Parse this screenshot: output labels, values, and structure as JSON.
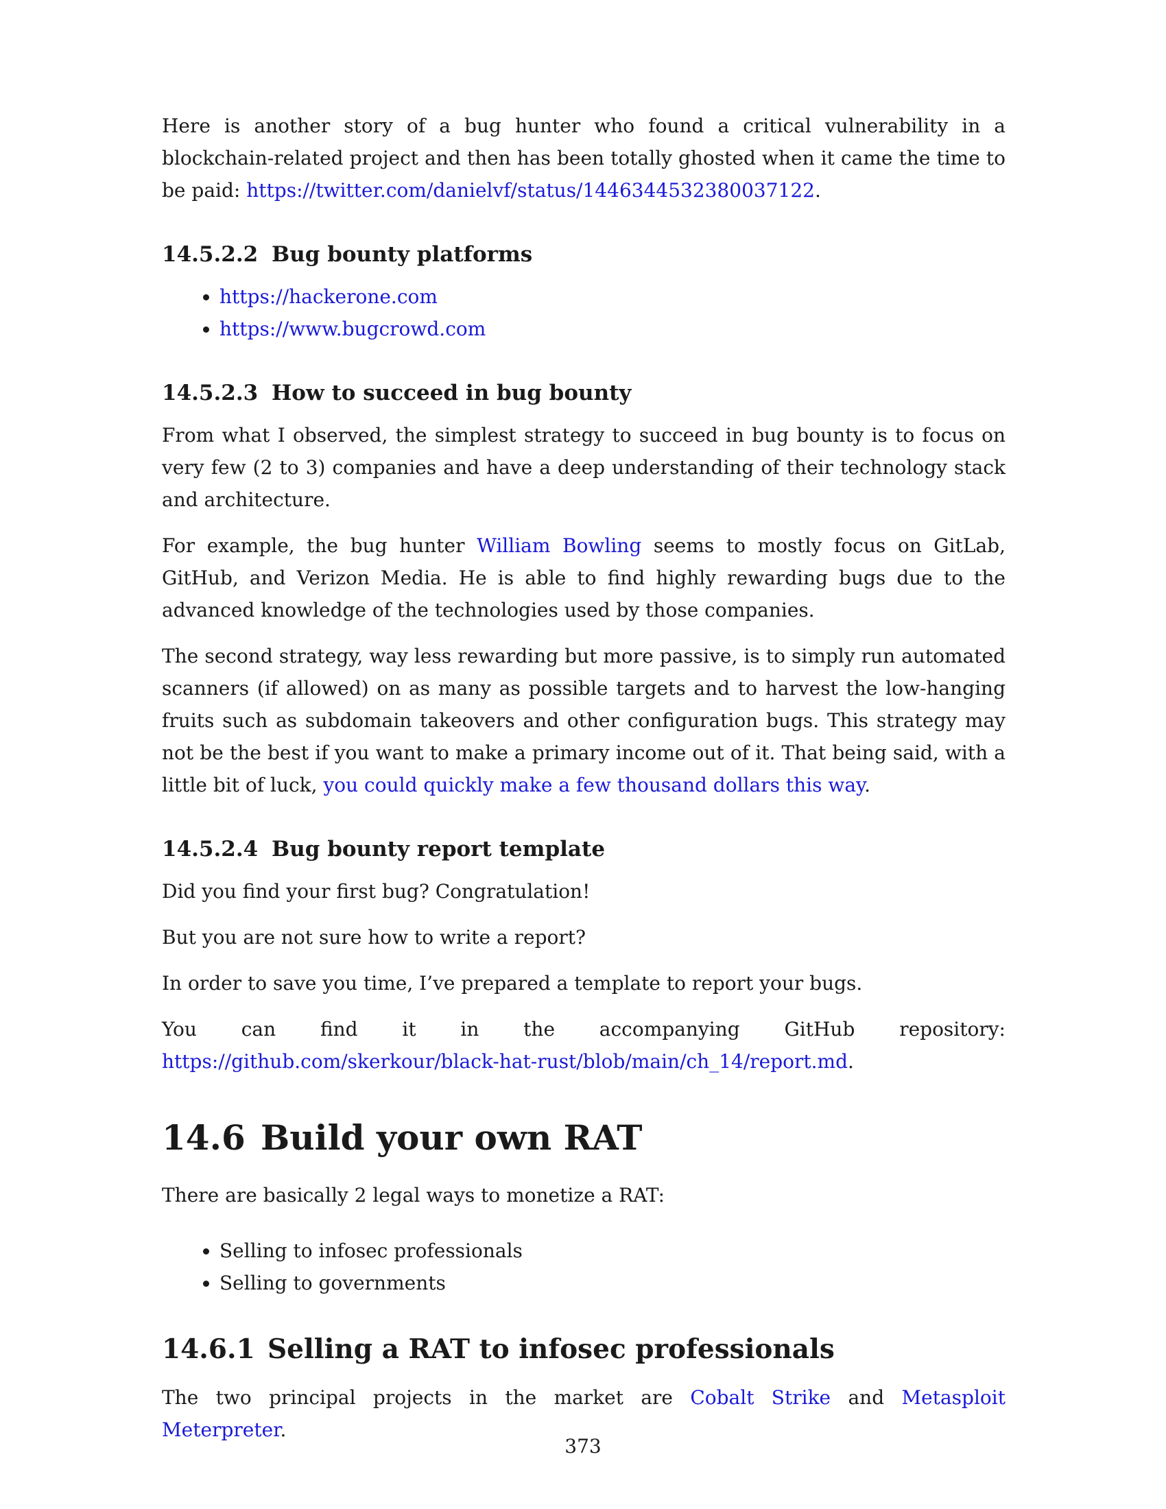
{
  "intro": {
    "text": "Here is another story of a bug hunter who found a critical vulnerability in a blockchain-related project and then has been totally ghosted when it came the time to be paid: ",
    "link": "https://twitter.com/danielvf/status/1446344532380037122",
    "end": "."
  },
  "sec_14_5_2_2": {
    "number": "14.5.2.2",
    "title": "Bug bounty platforms",
    "links": [
      "https://hackerone.com",
      "https://www.bugcrowd.com"
    ]
  },
  "sec_14_5_2_3": {
    "number": "14.5.2.3",
    "title": "How to succeed in bug bounty",
    "p1": "From what I observed, the simplest strategy to succeed in bug bounty is to focus on very few (2 to 3) companies and have a deep understanding of their technology stack and architecture.",
    "p2_a": "For example, the bug hunter ",
    "p2_link": "William Bowling",
    "p2_b": " seems to mostly focus on GitLab, GitHub, and Verizon Media. He is able to find highly rewarding bugs due to the advanced knowledge of the technologies used by those companies.",
    "p3_a": "The second strategy, way less rewarding but more passive, is to simply run automated scanners (if allowed) on as many as possible targets and to harvest the low-hanging fruits such as subdomain takeovers and other configuration bugs. This strategy may not be the best if you want to make a primary income out of it. That being said, with a little bit of luck, ",
    "p3_link": "you could quickly make a few thousand dollars this way",
    "p3_end": "."
  },
  "sec_14_5_2_4": {
    "number": "14.5.2.4",
    "title": "Bug bounty report template",
    "p1": "Did you find your first bug? Congratulation!",
    "p2": "But you are not sure how to write a report?",
    "p3": "In order to save you time, I’ve prepared a template to report your bugs.",
    "p4_a": "You can find it in the accompanying GitHub repository: ",
    "p4_link": "https://github.com/skerkour/black-hat-rust/blob/main/ch_14/report.md",
    "p4_end": "."
  },
  "sec_14_6": {
    "number": "14.6",
    "title": "Build your own RAT",
    "p1": "There are basically 2 legal ways to monetize a RAT:",
    "items": [
      "Selling to infosec professionals",
      "Selling to governments"
    ]
  },
  "sec_14_6_1": {
    "number": "14.6.1",
    "title": "Selling a RAT to infosec professionals",
    "p1_a": "The two principal projects in the market are ",
    "link1": "Cobalt Strike",
    "p1_mid": " and ",
    "link2": "Metasploit Meterpreter",
    "p1_end": "."
  },
  "footer": {
    "page_number": "373"
  }
}
